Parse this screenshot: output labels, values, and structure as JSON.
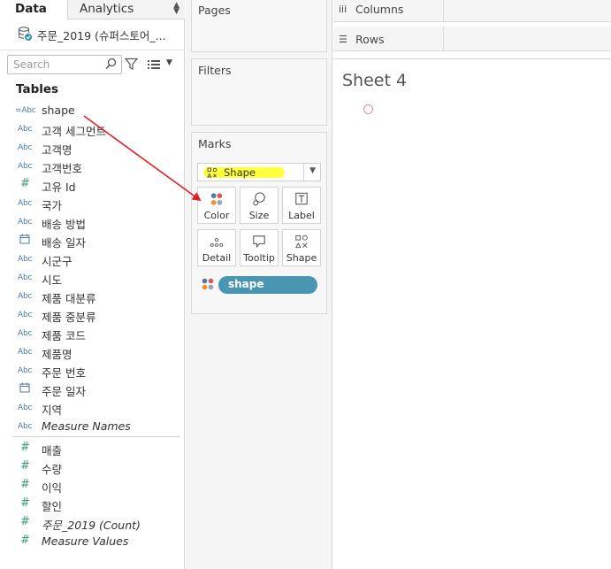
{
  "left_pane": {
    "tabs": {
      "data": "Data",
      "analytics": "Analytics"
    },
    "datasource": "주문_2019 (슈퍼스토어_...",
    "search_placeholder": "Search",
    "tables_title": "Tables",
    "dimensions": [
      {
        "type": "abc-calc",
        "name": "shape"
      },
      {
        "type": "abc",
        "name": "고객 세그먼트"
      },
      {
        "type": "abc",
        "name": "고객명"
      },
      {
        "type": "abc",
        "name": "고객번호"
      },
      {
        "type": "number",
        "name": "고유 Id"
      },
      {
        "type": "abc",
        "name": "국가"
      },
      {
        "type": "abc",
        "name": "배송 방법"
      },
      {
        "type": "date",
        "name": "배송 일자"
      },
      {
        "type": "abc",
        "name": "시군구"
      },
      {
        "type": "abc",
        "name": "시도"
      },
      {
        "type": "abc",
        "name": "제품 대분류"
      },
      {
        "type": "abc",
        "name": "제품 중분류"
      },
      {
        "type": "abc",
        "name": "제품 코드"
      },
      {
        "type": "abc",
        "name": "제품명"
      },
      {
        "type": "abc",
        "name": "주문 번호"
      },
      {
        "type": "date",
        "name": "주문 일자"
      },
      {
        "type": "abc",
        "name": "지역"
      },
      {
        "type": "abc",
        "name": "Measure Names",
        "italic": true
      }
    ],
    "measures": [
      {
        "type": "number",
        "name": "매출"
      },
      {
        "type": "number",
        "name": "수량"
      },
      {
        "type": "number",
        "name": "이익"
      },
      {
        "type": "number",
        "name": "할인"
      },
      {
        "type": "number",
        "name": "주문_2019 (Count)",
        "italic": true
      },
      {
        "type": "number",
        "name": "Measure Values",
        "italic": true
      }
    ]
  },
  "shelves": {
    "pages": "Pages",
    "filters": "Filters",
    "columns": "Columns",
    "rows": "Rows"
  },
  "marks": {
    "title": "Marks",
    "mark_type": "Shape",
    "buttons": {
      "color": "Color",
      "size": "Size",
      "label": "Label",
      "detail": "Detail",
      "tooltip": "Tooltip",
      "shape": "Shape"
    },
    "pill": "shape"
  },
  "view": {
    "sheet_title": "Sheet 4",
    "mark_color": "#e78a94"
  },
  "colors": {
    "pill": "#4996b2",
    "highlight": "#ffff3c",
    "annotation_arrow": "#e02020"
  }
}
